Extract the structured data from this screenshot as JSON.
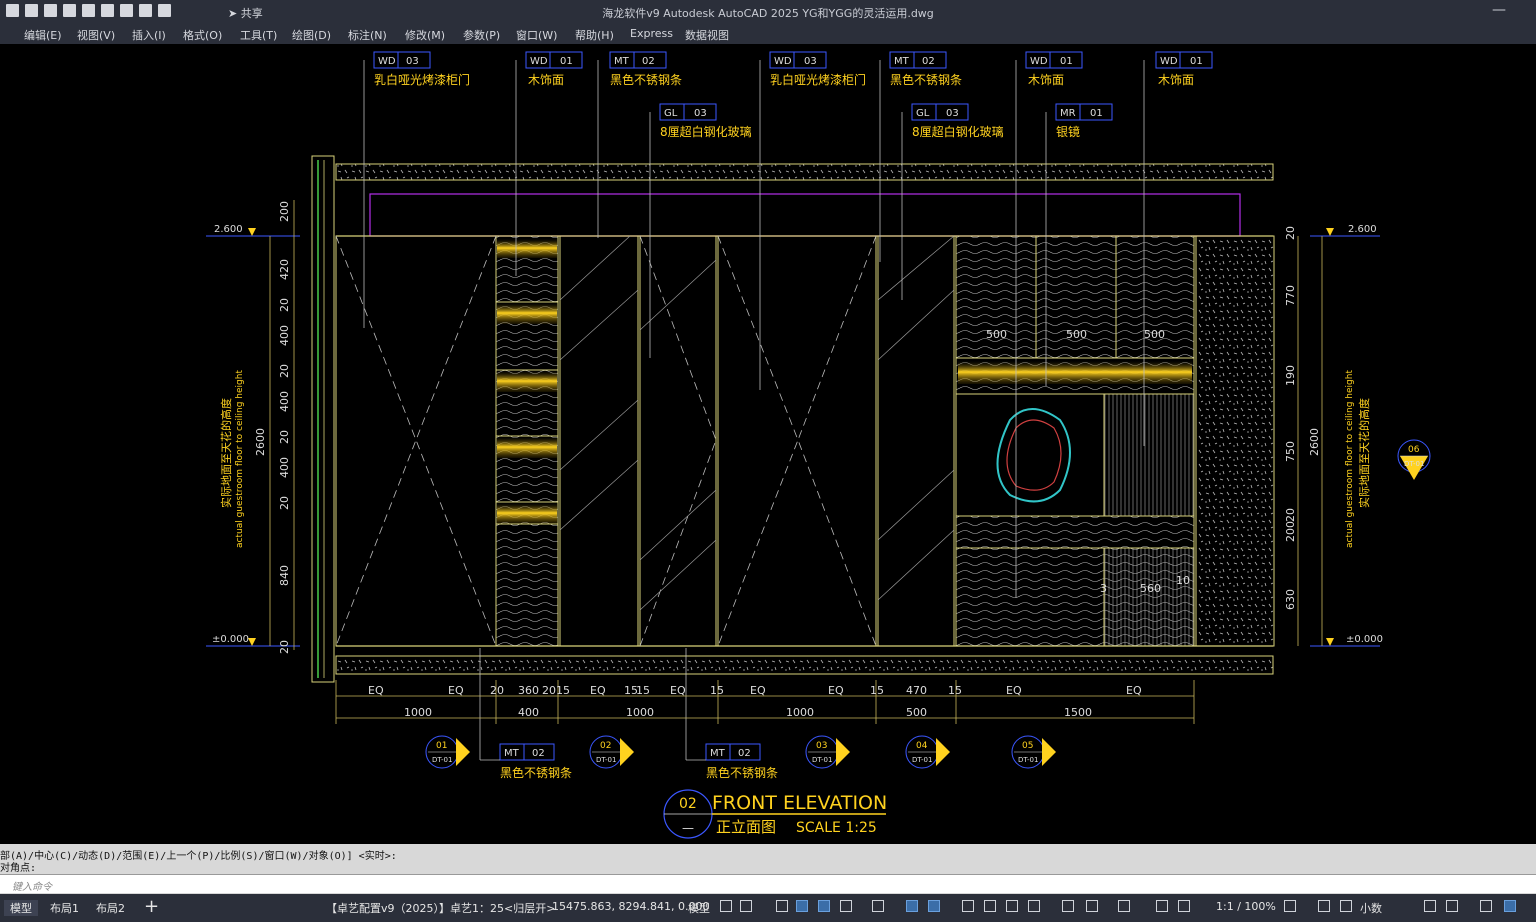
{
  "titlebar": {
    "share_label": "共享",
    "title": "海龙软件v9 Autodesk AutoCAD 2025    YG和YGG的灵活运用.dwg",
    "minimize": "—"
  },
  "menu": [
    "编辑(E)",
    "视图(V)",
    "插入(I)",
    "格式(O)",
    "工具(T)",
    "绘图(D)",
    "标注(N)",
    "修改(M)",
    "参数(P)",
    "窗口(W)",
    "帮助(H)",
    "Express",
    "数据视图"
  ],
  "drawing": {
    "tags": [
      {
        "code": "WD",
        "num": "03",
        "desc": "乳白哑光烤漆柜门"
      },
      {
        "code": "WD",
        "num": "01",
        "desc": "木饰面"
      },
      {
        "code": "MT",
        "num": "02",
        "desc": "黑色不锈钢条"
      },
      {
        "code": "GL",
        "num": "03",
        "desc": "8厘超白钢化玻璃"
      },
      {
        "code": "WD",
        "num": "03",
        "desc": "乳白哑光烤漆柜门"
      },
      {
        "code": "MT",
        "num": "02",
        "desc": "黑色不锈钢条"
      },
      {
        "code": "GL",
        "num": "03",
        "desc": "8厘超白钢化玻璃"
      },
      {
        "code": "WD",
        "num": "01",
        "desc": "木饰面"
      },
      {
        "code": "MR",
        "num": "01",
        "desc": "银镜"
      },
      {
        "code": "WD",
        "num": "01",
        "desc": "木饰面"
      }
    ],
    "bottom_tags": [
      {
        "code": "MT",
        "num": "02",
        "desc": "黑色不锈钢条"
      },
      {
        "code": "MT",
        "num": "02",
        "desc": "黑色不锈钢条"
      }
    ],
    "level_top": "2.600",
    "level_bottom": "±0.000",
    "height_note_cn": "实际地面至天花的高度",
    "height_note_en": "actual guestroom floor to ceiling height",
    "left_dims": [
      "200",
      "420",
      "20",
      "400",
      "20",
      "400",
      "20",
      "400",
      "20",
      "840",
      "20"
    ],
    "left_total": "2600",
    "right_dims": [
      "770",
      "190",
      "750",
      "20",
      "200",
      "630",
      "20"
    ],
    "right_total": "2600",
    "bottom_dims_row1": [
      "EQ",
      "EQ",
      "20",
      "360",
      "20",
      "15",
      "EQ",
      "15",
      "15",
      "EQ",
      "15",
      "EQ",
      "EQ",
      "15",
      "470",
      "15",
      "EQ",
      "EQ"
    ],
    "bottom_dims_row2": [
      "1000",
      "400",
      "1000",
      "1000",
      "500",
      "1500"
    ],
    "inner_dims": [
      "500",
      "500",
      "500",
      "560",
      "3",
      "10"
    ],
    "section_marks": [
      {
        "num": "01",
        "ref": "DT-01"
      },
      {
        "num": "02",
        "ref": "DT-01"
      },
      {
        "num": "03",
        "ref": "DT-01"
      },
      {
        "num": "04",
        "ref": "DT-01"
      },
      {
        "num": "05",
        "ref": "DT-01"
      },
      {
        "num": "06",
        "ref": "DT-01"
      }
    ],
    "title_block": {
      "num": "02",
      "sheet": "—",
      "title_en": "FRONT ELEVATION",
      "title_cn": "正立面图",
      "scale": "SCALE 1:25"
    }
  },
  "command": {
    "line1": "部(A)/中心(C)/动态(D)/范围(E)/上一个(P)/比例(S)/窗口(W)/对象(O)] <实时>:",
    "line2": "对角点:",
    "placeholder": "键入命令"
  },
  "status": {
    "tabs": [
      "模型",
      "布局1",
      "布局2"
    ],
    "workspace": "【卓艺配置v9（2025）】卓艺1：25<归层开>",
    "coords": "15475.863, 8294.841, 0.000",
    "model_label": "模型",
    "scale": "1:1 / 100%",
    "units": "小数"
  },
  "colors": {
    "chrome": "#2b2f3a",
    "drawing_line": "#d9d27a",
    "dim": "#c9b75a",
    "tag_box": "#3b57ff",
    "accent_yellow": "#ffd21f",
    "purple": "#b42ee8",
    "cyan": "#31c5c8"
  }
}
